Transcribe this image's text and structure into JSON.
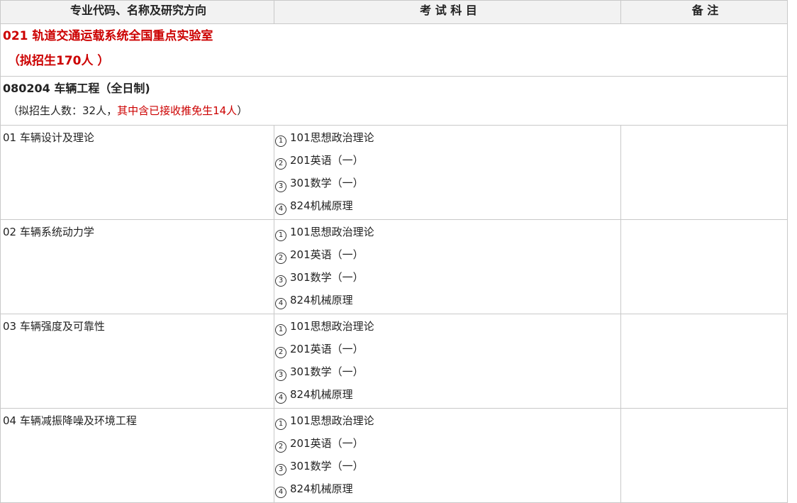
{
  "header": {
    "col1": "专业代码、名称及研究方向",
    "col2": "考 试 科 目",
    "col3": "备 注"
  },
  "lab": {
    "name": "021 轨道交通运载系统全国重点实验室",
    "enroll": "（拟招生170人 ）"
  },
  "major": {
    "name": "080204 车辆工程（全日制)",
    "enroll_prefix": "（拟招生人数：32人，",
    "enroll_highlight": "其中含已接收推免生14人",
    "enroll_suffix": "）"
  },
  "directions": [
    {
      "name": "01 车辆设计及理论",
      "exams": [
        {
          "num": "1",
          "subject": "101思想政治理论"
        },
        {
          "num": "2",
          "subject": "201英语（一）"
        },
        {
          "num": "3",
          "subject": "301数学（一）"
        },
        {
          "num": "4",
          "subject": "824机械原理"
        }
      ],
      "note": ""
    },
    {
      "name": "02 车辆系统动力学",
      "exams": [
        {
          "num": "1",
          "subject": "101思想政治理论"
        },
        {
          "num": "2",
          "subject": "201英语（一）"
        },
        {
          "num": "3",
          "subject": "301数学（一）"
        },
        {
          "num": "4",
          "subject": "824机械原理"
        }
      ],
      "note": ""
    },
    {
      "name": "03 车辆强度及可靠性",
      "exams": [
        {
          "num": "1",
          "subject": "101思想政治理论"
        },
        {
          "num": "2",
          "subject": "201英语（一）"
        },
        {
          "num": "3",
          "subject": "301数学（一）"
        },
        {
          "num": "4",
          "subject": "824机械原理"
        }
      ],
      "note": ""
    },
    {
      "name": "04 车辆减振降噪及环境工程",
      "exams": [
        {
          "num": "1",
          "subject": "101思想政治理论"
        },
        {
          "num": "2",
          "subject": "201英语（一）"
        },
        {
          "num": "3",
          "subject": "301数学（一）"
        },
        {
          "num": "4",
          "subject": "824机械原理"
        }
      ],
      "note": ""
    }
  ]
}
